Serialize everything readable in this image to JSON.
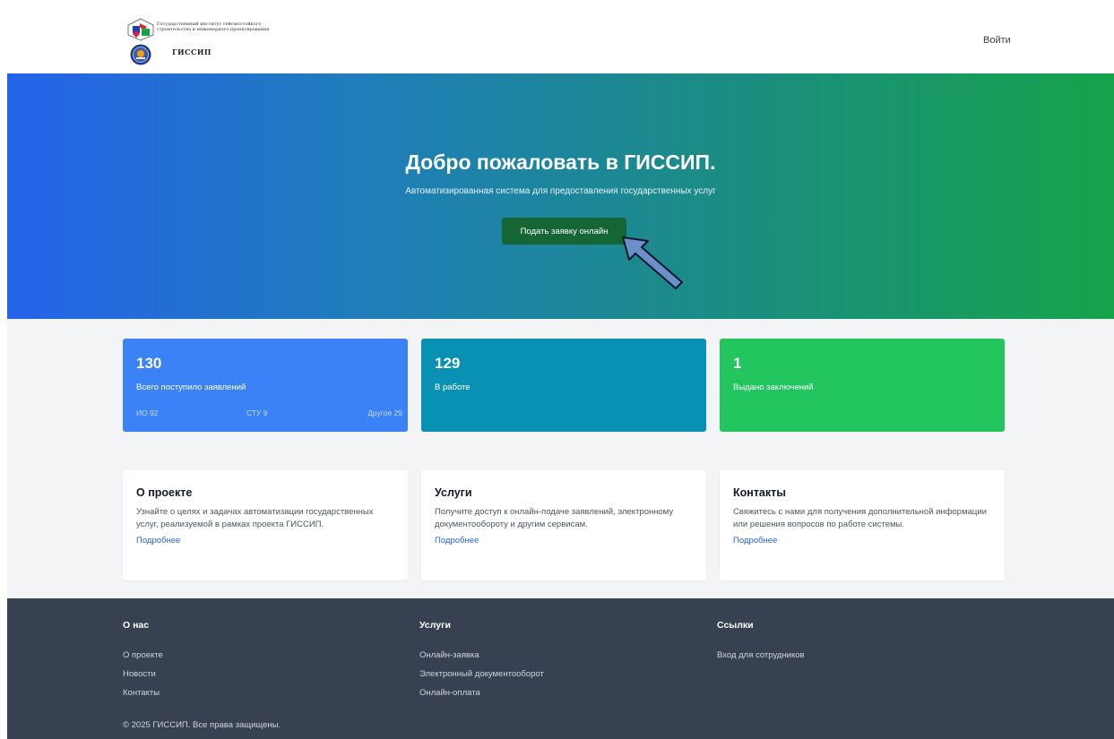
{
  "header": {
    "logo_text": "Государственный институт сейсмостойкого строительства и инженерного проектирования",
    "logo_abbr": "ГИССИП",
    "login_label": "Войти"
  },
  "hero": {
    "title": "Добро пожаловать в ГИССИП.",
    "subtitle": "Автоматизированная система для предоставления государственных услуг",
    "cta_label": "Подать заявку онлайн"
  },
  "stats": [
    {
      "value": "130",
      "label": "Всего поступило заявлений",
      "color": "#3b82f6",
      "breakdown": [
        "ИО 92",
        "СТУ 9",
        "Другое 29"
      ]
    },
    {
      "value": "129",
      "label": "В работе",
      "color": "#0891b2"
    },
    {
      "value": "1",
      "label": "Выдано заключений",
      "color": "#22c55e"
    }
  ],
  "info_cards": [
    {
      "title": "О проекте",
      "text": "Узнайте о целях и задачах автоматизации государственных услуг, реализуемой в рамках проекта ГИССИП.",
      "link": "Подробнее"
    },
    {
      "title": "Услуги",
      "text": "Получите доступ к онлайн-подаче заявлений, электронному документообороту и другим сервисам.",
      "link": "Подробнее"
    },
    {
      "title": "Контакты",
      "text": "Свяжитесь с нами для получения дополнительной информации или решения вопросов по работе системы.",
      "link": "Подробнее"
    }
  ],
  "footer": {
    "columns": [
      {
        "title": "О нас",
        "links": [
          "О проекте",
          "Новости",
          "Контакты"
        ]
      },
      {
        "title": "Услуги",
        "links": [
          "Онлайн-заявка",
          "Электронный документооборот",
          "Онлайн-оплата"
        ]
      },
      {
        "title": "Ссылки",
        "links": [
          "Вход для сотрудников"
        ]
      }
    ],
    "copyright": "© 2025 ГИССИП. Все права защищены."
  },
  "colors": {
    "hero_start": "#2563eb",
    "hero_end": "#16a34a",
    "cta_button": "#166534",
    "link": "#2563eb",
    "footer_bg": "#374151",
    "arrow_fill": "#6b8fc9"
  },
  "icons": [
    "institute-logo-icon",
    "seal-emblem-icon",
    "pointer-arrow-icon"
  ]
}
